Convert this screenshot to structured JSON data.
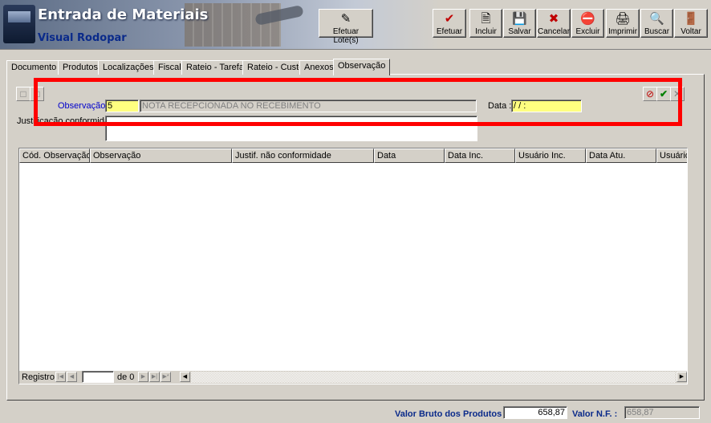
{
  "app": {
    "title": "Entrada de Materiais",
    "subtitle": "Visual Rodopar"
  },
  "toolbar": {
    "efetuar_lote": "Efetuar Lote(s)",
    "efetuar": "Efetuar",
    "incluir": "Incluir",
    "salvar": "Salvar",
    "cancelar": "Cancelar",
    "excluir": "Excluir",
    "imprimir": "Imprimir",
    "buscar": "Buscar",
    "voltar": "Voltar"
  },
  "tabs": [
    {
      "label": "Documento"
    },
    {
      "label": "Produtos"
    },
    {
      "label": "Localizações"
    },
    {
      "label": "Fiscal"
    },
    {
      "label": "Rateio - Tarefa"
    },
    {
      "label": "Rateio - Custo"
    },
    {
      "label": "Anexos"
    },
    {
      "label": "Observação",
      "active": true
    }
  ],
  "form": {
    "observacao_label": "Observação :",
    "observacao_code": "5",
    "observacao_text": "NOTA RECEPCIONADA NO RECEBIMENTO",
    "data_label": "Data :",
    "data_value": " / /      :",
    "justificativa_label": "Justificação conformidade :",
    "justificativa_value": ""
  },
  "grid": {
    "columns": [
      "Cód. Observação",
      "Observação",
      "Justif. não conformidade",
      "Data",
      "Data Inc.",
      "Usuário Inc.",
      "Data Atu.",
      "Usuário A"
    ],
    "rows": [],
    "footer": {
      "registro_label": "Registro:",
      "registro_value": "",
      "of_label": "de 0"
    }
  },
  "totals": {
    "valor_bruto_label": "Valor Bruto dos Produtos :",
    "valor_bruto_value": "658,87",
    "valor_nf_label": "Valor N.F. :",
    "valor_nf_value": "658,87"
  },
  "colors": {
    "highlight": "#ff0000",
    "field_yellow": "#ffff80",
    "label_blue": "#0000cc"
  }
}
